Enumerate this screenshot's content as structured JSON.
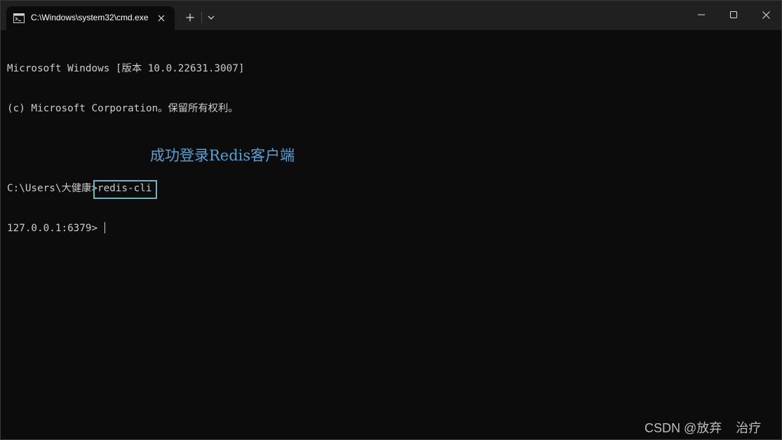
{
  "titlebar": {
    "tab_title": "C:\\Windows\\system32\\cmd.exe",
    "tab_icon": "cmd-icon",
    "close_tab_icon": "close-icon",
    "new_tab_icon": "plus-icon",
    "dropdown_icon": "chevron-down-icon",
    "minimize_icon": "minimize-icon",
    "maximize_icon": "maximize-icon",
    "close_window_icon": "close-icon"
  },
  "terminal": {
    "line1": "Microsoft Windows [版本 10.0.22631.3007]",
    "line2": "(c) Microsoft Corporation。保留所有权利。",
    "prompt_path": "C:\\Users\\大健康",
    "prompt_caret": ">",
    "command": "redis-cli",
    "redis_prompt": "127.0.0.1:6379> "
  },
  "annotation": {
    "text": "成功登录Redis客户端",
    "color": "#5a9fd6"
  },
  "watermark": {
    "text": "CSDN @放弃    治疗"
  },
  "colors": {
    "background": "#0c0c0c",
    "titlebar": "#202020",
    "text": "#cccccc",
    "highlight_border": "#6fb3c8"
  }
}
